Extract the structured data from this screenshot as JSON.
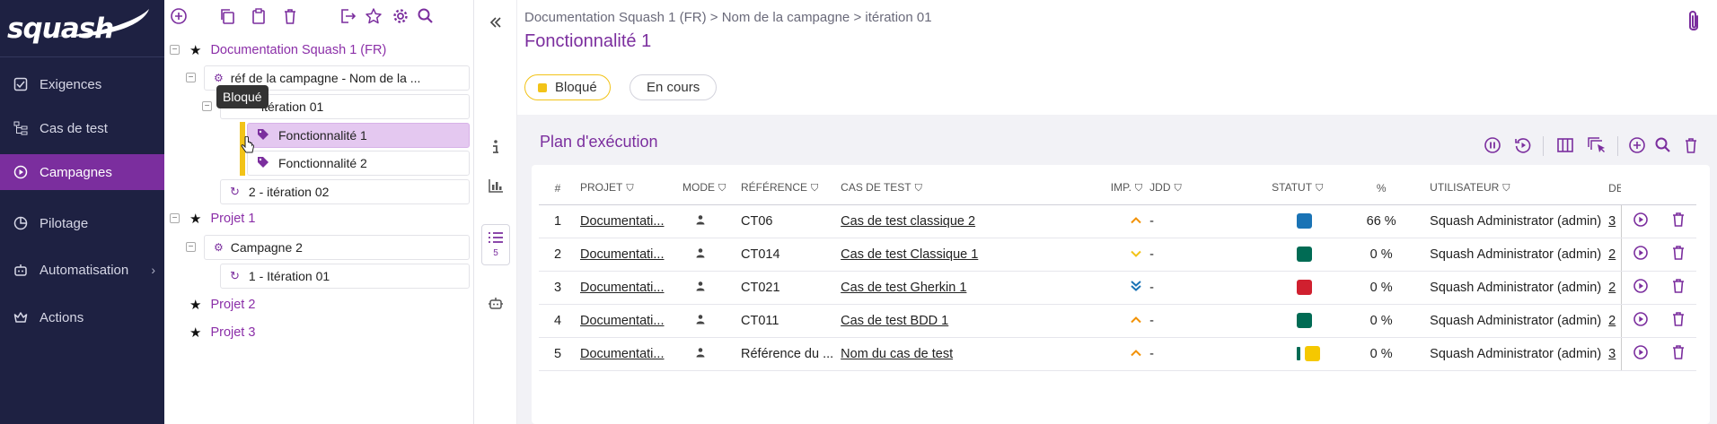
{
  "nav": {
    "logo": "squash",
    "items": [
      {
        "label": "Exigences",
        "icon": "checkbox-icon"
      },
      {
        "label": "Cas de test",
        "icon": "tree-icon"
      },
      {
        "label": "Campagnes",
        "icon": "play-circle-icon",
        "active": true
      },
      {
        "label": "Pilotage",
        "icon": "pie-chart-icon"
      },
      {
        "label": "Automatisation",
        "icon": "robot-icon",
        "chevron": "›"
      },
      {
        "label": "Actions",
        "icon": "crown-icon"
      }
    ]
  },
  "tree": {
    "nodes": {
      "doc": "Documentation Squash 1 (FR)",
      "campaign": "réf de la campagne - Nom de la ...",
      "iter01": "itération 01",
      "f1": "Fonctionnalité 1",
      "f2": "Fonctionnalité 2",
      "iter02": "2 - itération 02",
      "projet1": "Projet 1",
      "campagne2": "Campagne 2",
      "iter01b": "1 - Itération 01",
      "projet2": "Projet 2",
      "projet3": "Projet 3"
    },
    "tooltip": "Bloqué"
  },
  "strip": {
    "plan_count": "5"
  },
  "header": {
    "breadcrumb": "Documentation Squash 1 (FR) > Nom de la campagne > itération 01",
    "title": "Fonctionnalité 1",
    "status_pills": [
      "Bloqué",
      "En cours"
    ]
  },
  "plan": {
    "title": "Plan d'exécution",
    "columns": [
      "#",
      "PROJET",
      "MODE",
      "RÉFÉRENCE",
      "CAS DE TEST",
      "IMP.",
      "JDD",
      "STATUT",
      "%",
      "UTILISATEUR",
      "DE"
    ],
    "rows": [
      {
        "num": "1",
        "projet": "Documentati...",
        "ref": "CT06",
        "cas": "Cas de test classique 2",
        "imp": "^",
        "jdd": "-",
        "status_color": "#1a73b5",
        "pct": "66 %",
        "user": "Squash Administrator (admin)",
        "de": "3"
      },
      {
        "num": "2",
        "projet": "Documentati...",
        "ref": "CT014",
        "cas": "Cas de test Classique 1",
        "imp": "v",
        "jdd": "-",
        "status_color": "#006b54",
        "pct": "0 %",
        "user": "Squash Administrator (admin)",
        "de": "2"
      },
      {
        "num": "3",
        "projet": "Documentati...",
        "ref": "CT021",
        "cas": "Cas de test Gherkin 1",
        "imp": "«",
        "jdd": "-",
        "status_color": "#d0202f",
        "pct": "0 %",
        "user": "Squash Administrator (admin)",
        "de": "2"
      },
      {
        "num": "4",
        "projet": "Documentati...",
        "ref": "CT011",
        "cas": "Cas de test BDD 1",
        "imp": "^",
        "jdd": "-",
        "status_color": "#006b54",
        "pct": "0 %",
        "user": "Squash Administrator (admin)",
        "de": "2"
      },
      {
        "num": "5",
        "projet": "Documentati...",
        "ref": "Référence du ...",
        "cas": "Nom du cas de test",
        "imp": "^",
        "jdd": "-",
        "status_color": "#f5c800",
        "pct": "0 %",
        "user": "Squash Administrator (admin)",
        "de": "3"
      }
    ]
  },
  "colors": {
    "accent": "#7b2e9e",
    "nav_bg": "#1e2142",
    "blocked": "#f2c318",
    "high_imp": "#f29100",
    "low_imp": "#f2c318",
    "very_low_imp": "#1a73b5"
  }
}
